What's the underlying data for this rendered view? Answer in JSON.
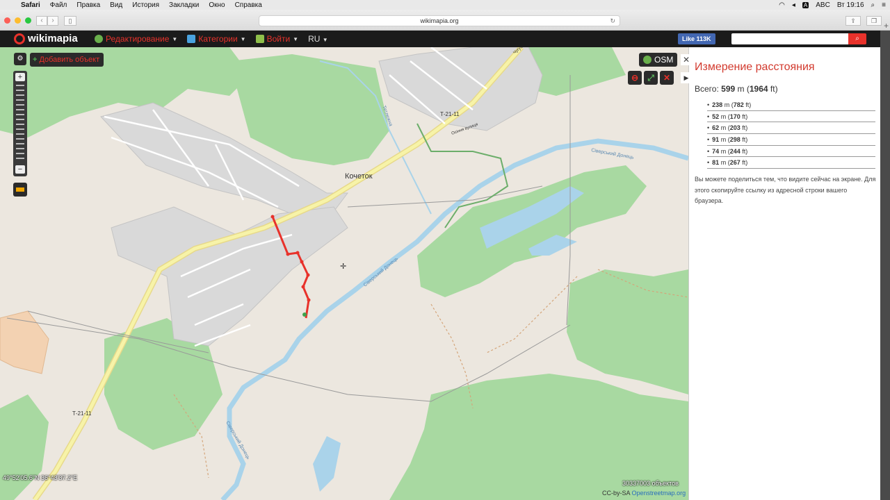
{
  "menubar": {
    "app": "Safari",
    "items": [
      "Файл",
      "Правка",
      "Вид",
      "История",
      "Закладки",
      "Окно",
      "Справка"
    ],
    "input_source": "ABC",
    "clock": "Вт 19:16"
  },
  "browser": {
    "url": "wikimapia.org"
  },
  "wikimapia": {
    "logo_text": "wikimapia",
    "nav": [
      {
        "label": "Редактирование"
      },
      {
        "label": "Категории"
      },
      {
        "label": "Войти"
      }
    ],
    "language": "RU",
    "like_label": "Like",
    "like_count": "113K"
  },
  "map": {
    "add_object_label": "Добавить объект",
    "layer_label": "OSM",
    "labels": {
      "village": "Кочеток",
      "road_1": "Т-21-11",
      "road_2": "Т-21-11",
      "street": "Осіння вулиця",
      "river_1": "Сіверський Донець",
      "river_2": "Сіверський Донець",
      "river_3": "Сіверський Донець",
      "creek": "Тетлежна",
      "road_top": "Чугуївська"
    },
    "coordinates": "49°52'05.6\"N 36°43'37.2\"E",
    "object_count": "30337003 объектов",
    "attribution_prefix": "CC-by-SA",
    "attribution_link": "Openstreetmap.org"
  },
  "measure_panel": {
    "title": "Измерение расстояния",
    "total_label": "Всего:",
    "total_m": "599",
    "total_ft": "1964",
    "unit_m": "m",
    "unit_ft": "ft",
    "segments": [
      {
        "m": "238",
        "ft": "782"
      },
      {
        "m": "52",
        "ft": "170"
      },
      {
        "m": "62",
        "ft": "203"
      },
      {
        "m": "91",
        "ft": "298"
      },
      {
        "m": "74",
        "ft": "244"
      },
      {
        "m": "81",
        "ft": "267"
      }
    ],
    "note": "Вы можете поделиться тем, что видите сейчас на экране. Для этого скопируйте ссылку из адресной строки вашего браузера."
  },
  "colors": {
    "accent": "#e8322b",
    "forest": "#a7d8a0",
    "residential": "#d8d8d8",
    "water": "#a9d3ea",
    "road_major": "#f7f3a0"
  }
}
